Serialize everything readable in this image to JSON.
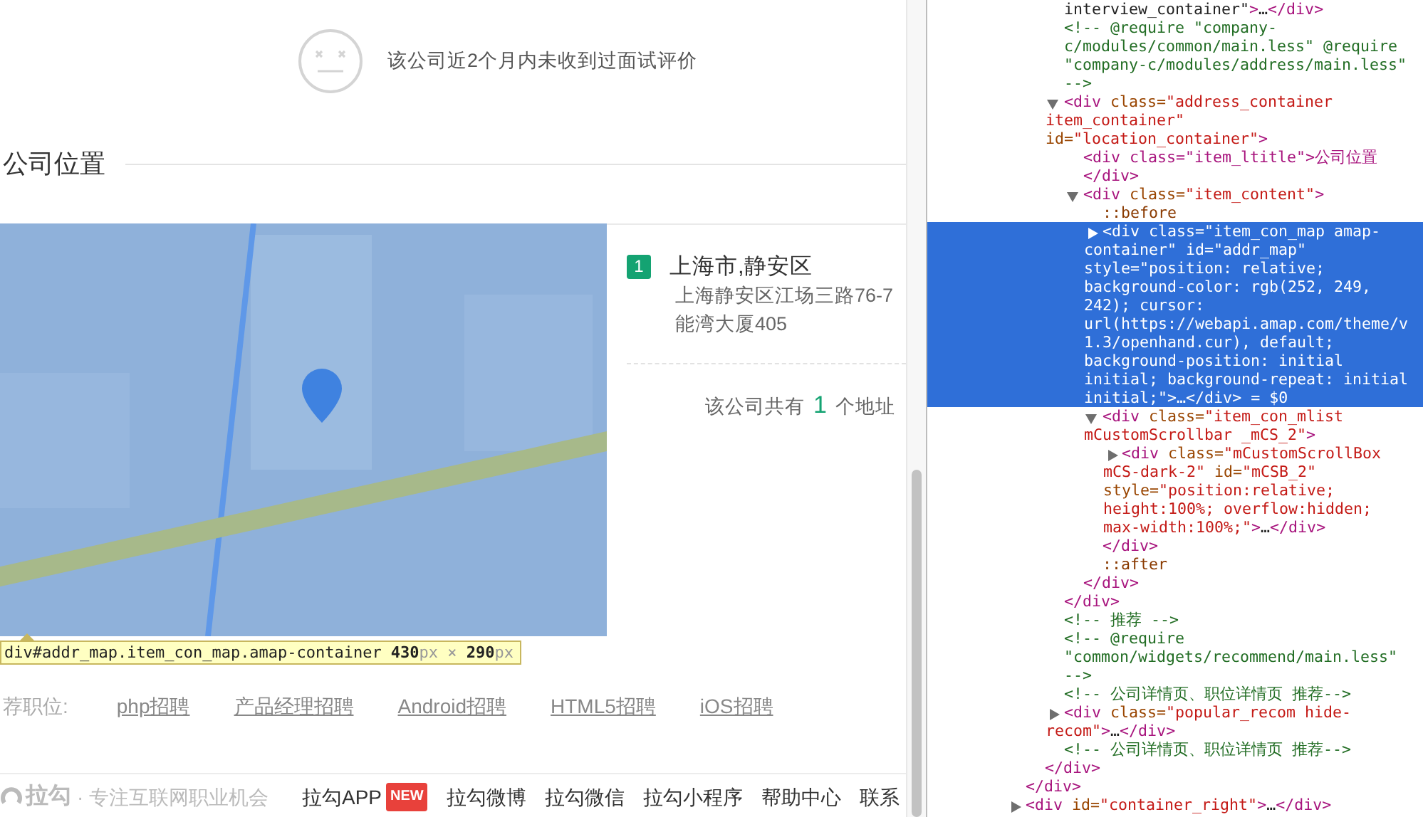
{
  "review": {
    "message": "该公司近2个月内未收到过面试评价"
  },
  "location": {
    "title": "公司位置",
    "inspector_tooltip": {
      "selector": "div#addr_map.item_con_map.amap-container",
      "size": "**430**px × **290**px"
    },
    "addresses": [
      {
        "index": "1",
        "city": "上海市,静安区",
        "lines": [
          "上海静安区江场三路76-7",
          "能湾大厦405"
        ]
      }
    ],
    "summary": {
      "prefix": "该公司共有",
      "count": "1",
      "suffix": "个地址"
    }
  },
  "recommend": {
    "label": "荐职位:",
    "links": [
      "php招聘",
      "产品经理招聘",
      "Android招聘",
      "HTML5招聘",
      "iOS招聘"
    ]
  },
  "footer": {
    "logo": "拉勾",
    "slogan": "· 专注互联网职业机会",
    "links": [
      {
        "label": "拉勾APP",
        "badge": "NEW"
      },
      {
        "label": "拉勾微博"
      },
      {
        "label": "拉勾微信"
      },
      {
        "label": "拉勾小程序"
      },
      {
        "label": "帮助中心"
      },
      {
        "label": "联系"
      }
    ]
  },
  "devtools": {
    "nodes": [
      {
        "kind": "parent",
        "close": "</div>",
        "children": [
          {
            "kind": "parent",
            "close": "</div>",
            "children": [
              {
                "kind": "fragment",
                "text": "interview_container\">…</div>"
              },
              {
                "kind": "comment",
                "text": "<!-- @require \"company-c/modules/common/main.less\" @require \"company-c/modules/address/main.less\" -->"
              },
              {
                "kind": "element",
                "text": "<div class=\"address_container item_container\" id=\"location_container\">",
                "expanded": true,
                "selected": false,
                "close": "</div>",
                "children": [
                  {
                    "kind": "element",
                    "text": "<div class=\"item_ltitle\">公司位置</div>",
                    "selected": false
                  },
                  {
                    "kind": "element",
                    "text": "<div class=\"item_content\">",
                    "expanded": true,
                    "selected": false,
                    "close": "</div>",
                    "children": [
                      {
                        "kind": "pseudo",
                        "text": "::before"
                      },
                      {
                        "kind": "element",
                        "text": "<div class=\"item_con_map amap-container\" id=\"addr_map\" style=\"position: relative; background-color: rgb(252, 249, 242); cursor: url(https://webapi.amap.com/theme/v1.3/openhand.cur), default; background-position: initial initial; background-repeat: initial initial;\">…</div>",
                        "expanded": false,
                        "selected": true,
                        "console_ref": "= $0"
                      },
                      {
                        "kind": "element",
                        "text": "<div class=\"item_con_mlist mCustomScrollbar _mCS_2\">",
                        "expanded": true,
                        "selected": false,
                        "close": "</div>",
                        "children": [
                          {
                            "kind": "element",
                            "text": "<div class=\"mCustomScrollBox mCS-dark-2\" id=\"mCSB_2\" style=\"position:relative; height:100%; overflow:hidden; max-width:100%;\">…</div>",
                            "expanded": false,
                            "selected": false
                          }
                        ]
                      },
                      {
                        "kind": "pseudo",
                        "text": "::after"
                      }
                    ]
                  }
                ]
              },
              {
                "kind": "comment",
                "text": "<!-- 推荐 -->"
              },
              {
                "kind": "comment",
                "text": "<!-- @require \"common/widgets/recommend/main.less\" -->"
              },
              {
                "kind": "comment",
                "text": "<!-- 公司详情页、职位详情页 推荐-->"
              },
              {
                "kind": "element",
                "text": "<div class=\"popular_recom hide-recom\">…</div>",
                "expanded": false,
                "selected": false
              },
              {
                "kind": "comment",
                "text": "<!-- 公司详情页、职位详情页 推荐-->"
              }
            ]
          }
        ]
      },
      {
        "kind": "element",
        "text": "<div id=\"container_right\">…</div>",
        "expanded": false,
        "selected": false
      }
    ]
  }
}
